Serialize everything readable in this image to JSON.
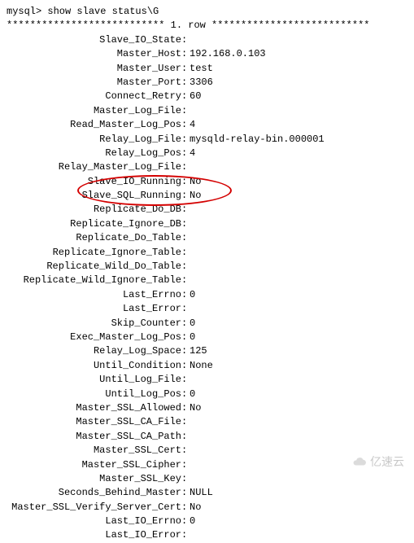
{
  "prompt": "mysql> show slave status\\G",
  "row_header": "*************************** 1. row ***************************",
  "rows": [
    {
      "label": "Slave_IO_State",
      "value": ""
    },
    {
      "label": "Master_Host",
      "value": "192.168.0.103"
    },
    {
      "label": "Master_User",
      "value": "test"
    },
    {
      "label": "Master_Port",
      "value": "3306"
    },
    {
      "label": "Connect_Retry",
      "value": "60"
    },
    {
      "label": "Master_Log_File",
      "value": ""
    },
    {
      "label": "Read_Master_Log_Pos",
      "value": "4"
    },
    {
      "label": "Relay_Log_File",
      "value": "mysqld-relay-bin.000001"
    },
    {
      "label": "Relay_Log_Pos",
      "value": "4"
    },
    {
      "label": "Relay_Master_Log_File",
      "value": ""
    },
    {
      "label": "Slave_IO_Running",
      "value": "No"
    },
    {
      "label": "Slave_SQL_Running",
      "value": "No"
    },
    {
      "label": "Replicate_Do_DB",
      "value": ""
    },
    {
      "label": "Replicate_Ignore_DB",
      "value": ""
    },
    {
      "label": "Replicate_Do_Table",
      "value": ""
    },
    {
      "label": "Replicate_Ignore_Table",
      "value": ""
    },
    {
      "label": "Replicate_Wild_Do_Table",
      "value": ""
    },
    {
      "label": "Replicate_Wild_Ignore_Table",
      "value": ""
    },
    {
      "label": "Last_Errno",
      "value": "0"
    },
    {
      "label": "Last_Error",
      "value": ""
    },
    {
      "label": "Skip_Counter",
      "value": "0"
    },
    {
      "label": "Exec_Master_Log_Pos",
      "value": "0"
    },
    {
      "label": "Relay_Log_Space",
      "value": "125"
    },
    {
      "label": "Until_Condition",
      "value": "None"
    },
    {
      "label": "Until_Log_File",
      "value": ""
    },
    {
      "label": "Until_Log_Pos",
      "value": "0"
    },
    {
      "label": "Master_SSL_Allowed",
      "value": "No"
    },
    {
      "label": "Master_SSL_CA_File",
      "value": ""
    },
    {
      "label": "Master_SSL_CA_Path",
      "value": ""
    },
    {
      "label": "Master_SSL_Cert",
      "value": ""
    },
    {
      "label": "Master_SSL_Cipher",
      "value": ""
    },
    {
      "label": "Master_SSL_Key",
      "value": ""
    },
    {
      "label": "Seconds_Behind_Master",
      "value": "NULL"
    },
    {
      "label": "Master_SSL_Verify_Server_Cert",
      "value": "No"
    },
    {
      "label": "Last_IO_Errno",
      "value": "0"
    },
    {
      "label": "Last_IO_Error",
      "value": ""
    }
  ],
  "watermark_text": "亿速云"
}
